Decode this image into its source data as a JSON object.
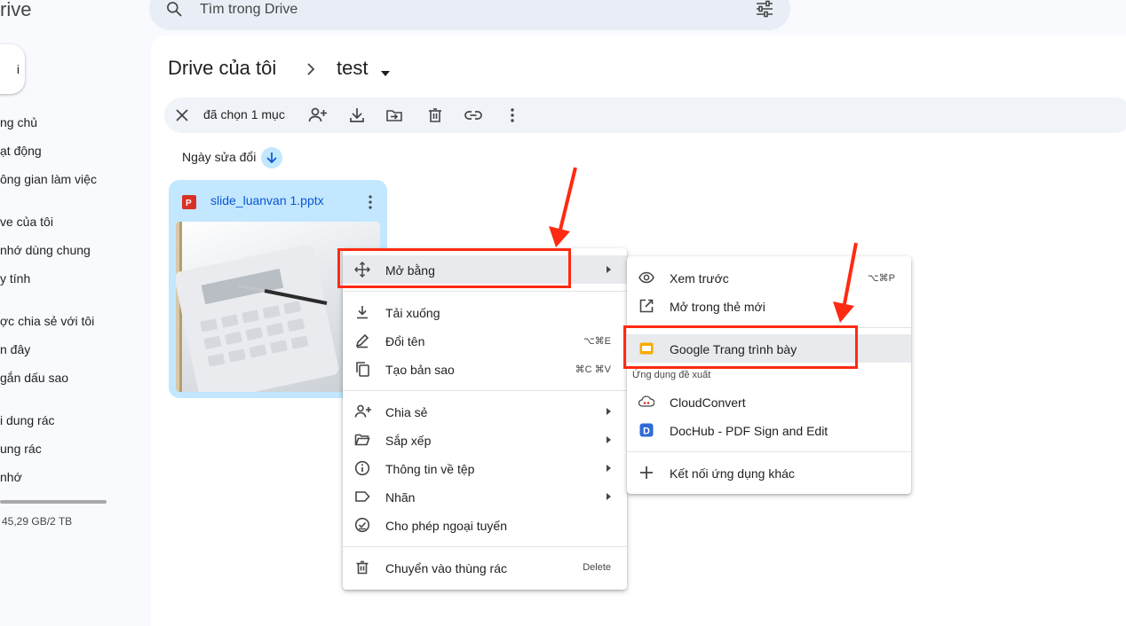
{
  "app": {
    "logo_text": "rive",
    "new_label": "i"
  },
  "search": {
    "placeholder": "Tìm trong Drive"
  },
  "sidebar": {
    "items": [
      {
        "label": "ng chủ"
      },
      {
        "label": "ạt động"
      },
      {
        "label": "ông gian làm việc"
      },
      {
        "label": "ve của tôi"
      },
      {
        "label": "nhớ dùng chung"
      },
      {
        "label": "y tính"
      },
      {
        "label": "ợc chia sẻ với tôi"
      },
      {
        "label": "n đây"
      },
      {
        "label": "gắn dấu sao"
      },
      {
        "label": "i dung rác"
      },
      {
        "label": "ung rác"
      },
      {
        "label": "nhớ"
      }
    ],
    "storage_text": "45,29 GB/2 TB"
  },
  "breadcrumb": {
    "parent": "Drive của tôi",
    "current": "test"
  },
  "selection": {
    "text": "đã chọn 1 mục"
  },
  "sort": {
    "label": "Ngày sửa đổi"
  },
  "file": {
    "name": "slide_luanvan 1.pptx"
  },
  "context_menu": {
    "open_with": "Mở bằng",
    "download": "Tải xuống",
    "rename": "Đổi tên",
    "rename_shortcut": "⌥⌘E",
    "copy": "Tạo bản sao",
    "copy_shortcut": "⌘C ⌘V",
    "share": "Chia sẻ",
    "organize": "Sắp xếp",
    "file_info": "Thông tin về tệp",
    "labels": "Nhãn",
    "offline": "Cho phép ngoại tuyến",
    "trash": "Chuyển vào thùng rác",
    "trash_shortcut": "Delete"
  },
  "submenu": {
    "preview": "Xem trước",
    "preview_shortcut": "⌥⌘P",
    "new_tab": "Mở trong thẻ mới",
    "slides": "Google Trang trình bày",
    "suggested_header": "Ứng dụng đề xuất",
    "cloudconvert": "CloudConvert",
    "dochub": "DocHub - PDF Sign and Edit",
    "connect_more": "Kết nối ứng dụng khác"
  },
  "colors": {
    "accent": "#0b57d0",
    "selected": "#c2e7ff",
    "annotation": "#ff2a12",
    "slides_yellow": "#f9ab00"
  }
}
